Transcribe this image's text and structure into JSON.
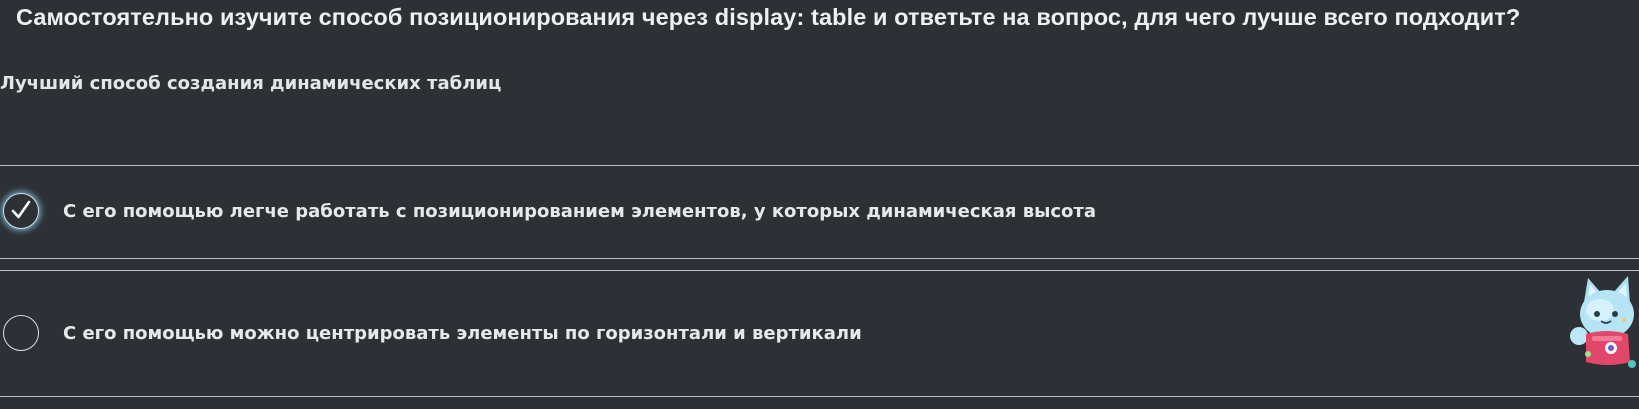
{
  "question": "Самостоятельно изучите способ позиционирования через display: table и ответьте на вопрос, для чего лучше всего подходит?",
  "hint": "Лучший способ создания динамических таблиц",
  "options": [
    {
      "label": "С его помощью легче работать с позиционированием элементов, у которых динамическая высота",
      "checked": true
    },
    {
      "label": "С его помощью можно центрировать элементы по горизонтали и вертикали",
      "checked": false
    }
  ],
  "colors": {
    "background": "#2d3136",
    "text": "#e6e9ec",
    "border": "#b9bec4",
    "glow": "#8cc8eb"
  },
  "icons": {
    "check": "checkmark-icon",
    "mascot": "mascot-icon"
  }
}
